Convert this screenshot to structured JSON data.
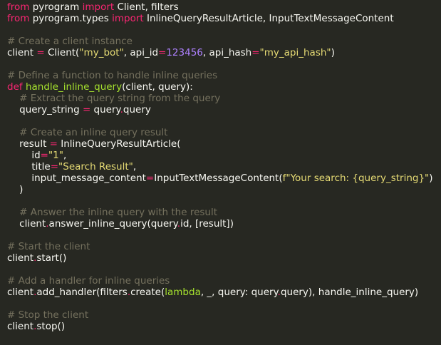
{
  "colors": {
    "background": "#272822",
    "default_text": "#f8f8f2",
    "keyword": "#f92672",
    "function": "#a6e22e",
    "string": "#e6db74",
    "number": "#ae81ff",
    "comment": "#75715e"
  },
  "lines": [
    [
      [
        "kw",
        "from"
      ],
      [
        "plain",
        " pyrogram "
      ],
      [
        "kw",
        "import"
      ],
      [
        "plain",
        " Client, filters"
      ]
    ],
    [
      [
        "kw",
        "from"
      ],
      [
        "plain",
        " pyrogram.types "
      ],
      [
        "kw",
        "import"
      ],
      [
        "plain",
        " InlineQueryResultArticle, InputTextMessageContent"
      ]
    ],
    [],
    [
      [
        "cm",
        "# Create a client instance"
      ]
    ],
    [
      [
        "plain",
        "client "
      ],
      [
        "op",
        "="
      ],
      [
        "plain",
        " Client("
      ],
      [
        "str",
        "\"my_bot\""
      ],
      [
        "plain",
        ", api_id"
      ],
      [
        "op",
        "="
      ],
      [
        "num",
        "123456"
      ],
      [
        "plain",
        ", api_hash"
      ],
      [
        "op",
        "="
      ],
      [
        "str",
        "\"my_api_hash\""
      ],
      [
        "plain",
        ")"
      ]
    ],
    [],
    [
      [
        "cm",
        "# Define a function to handle inline queries"
      ]
    ],
    [
      [
        "kw",
        "def"
      ],
      [
        "plain",
        " "
      ],
      [
        "fn",
        "handle_inline_query"
      ],
      [
        "plain",
        "(client, query):"
      ]
    ],
    [
      [
        "plain",
        "    "
      ],
      [
        "cm",
        "# Extract the query string from the query"
      ]
    ],
    [
      [
        "plain",
        "    query_string "
      ],
      [
        "op",
        "="
      ],
      [
        "plain",
        " query"
      ],
      [
        "op",
        "."
      ],
      [
        "plain",
        "query"
      ]
    ],
    [],
    [
      [
        "plain",
        "    "
      ],
      [
        "cm",
        "# Create an inline query result"
      ]
    ],
    [
      [
        "plain",
        "    result "
      ],
      [
        "op",
        "="
      ],
      [
        "plain",
        " InlineQueryResultArticle("
      ]
    ],
    [
      [
        "plain",
        "        id"
      ],
      [
        "op",
        "="
      ],
      [
        "str",
        "\"1\""
      ],
      [
        "plain",
        ","
      ]
    ],
    [
      [
        "plain",
        "        title"
      ],
      [
        "op",
        "="
      ],
      [
        "str",
        "\"Search Result\""
      ],
      [
        "plain",
        ","
      ]
    ],
    [
      [
        "plain",
        "        input_message_content"
      ],
      [
        "op",
        "="
      ],
      [
        "plain",
        "InputTextMessageContent("
      ],
      [
        "str",
        "f\"Your search: {query_string}\""
      ],
      [
        "plain",
        ")"
      ]
    ],
    [
      [
        "plain",
        "    )"
      ]
    ],
    [],
    [
      [
        "plain",
        "    "
      ],
      [
        "cm",
        "# Answer the inline query with the result"
      ]
    ],
    [
      [
        "plain",
        "    client"
      ],
      [
        "op",
        "."
      ],
      [
        "plain",
        "answer_inline_query(query"
      ],
      [
        "op",
        "."
      ],
      [
        "plain",
        "id, [result])"
      ]
    ],
    [],
    [
      [
        "cm",
        "# Start the client"
      ]
    ],
    [
      [
        "plain",
        "client"
      ],
      [
        "op",
        "."
      ],
      [
        "plain",
        "start()"
      ]
    ],
    [],
    [
      [
        "cm",
        "# Add a handler for inline queries"
      ]
    ],
    [
      [
        "plain",
        "client"
      ],
      [
        "op",
        "."
      ],
      [
        "plain",
        "add_handler(filters"
      ],
      [
        "op",
        "."
      ],
      [
        "plain",
        "create("
      ],
      [
        "fn",
        "lambda"
      ],
      [
        "plain",
        ", _, query: query"
      ],
      [
        "op",
        "."
      ],
      [
        "plain",
        "query), handle_inline_query)"
      ]
    ],
    [],
    [
      [
        "cm",
        "# Stop the client"
      ]
    ],
    [
      [
        "plain",
        "client"
      ],
      [
        "op",
        "."
      ],
      [
        "plain",
        "stop()"
      ]
    ]
  ]
}
